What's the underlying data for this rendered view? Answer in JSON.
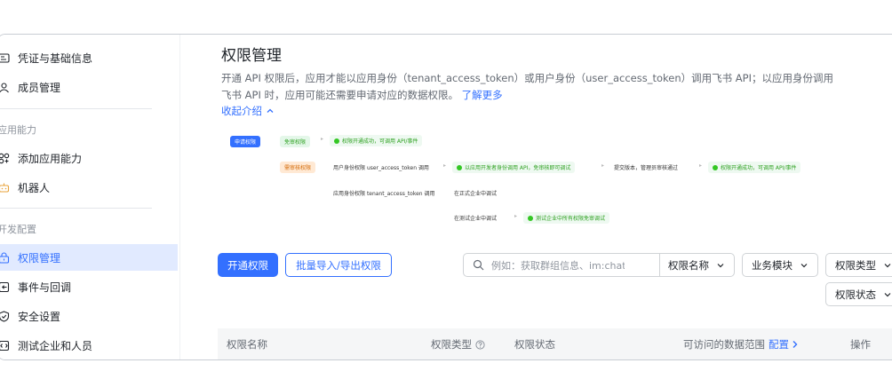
{
  "sidebar": {
    "items_top": [
      {
        "label": "凭证与基础信息",
        "icon": "credential-icon"
      },
      {
        "label": "成员管理",
        "icon": "members-icon"
      }
    ],
    "group_app": "应用能力",
    "items_app": [
      {
        "label": "添加应用能力",
        "icon": "add-capability-icon"
      },
      {
        "label": "机器人",
        "icon": "robot-icon"
      }
    ],
    "group_dev": "开发配置",
    "items_dev": [
      {
        "label": "权限管理",
        "icon": "permission-icon",
        "active": true
      },
      {
        "label": "事件与回调",
        "icon": "event-icon"
      },
      {
        "label": "安全设置",
        "icon": "security-icon"
      },
      {
        "label": "测试企业和人员",
        "icon": "test-org-icon"
      }
    ]
  },
  "page": {
    "title": "权限管理",
    "desc_main": "开通 API 权限后，应用才能以应用身份（tenant_access_token）或用户身份（user_access_token）调用飞书 API；以应用身份调用飞书 API 时，应用可能还需要申请对应的数据权限。",
    "desc_link": "了解更多",
    "collapse_label": "收起介绍"
  },
  "flow": {
    "apply": "申请权限",
    "no_review": "免审权限",
    "no_review_result": "权限开通成功，可调用 API/事件",
    "need_review": "需审核权限",
    "user_identity": "用户身份权限",
    "user_identity_token": "user_access_token 调用",
    "user_pill": "以应用开发者身份调用 API，免审核即可调试",
    "submit": "提交版本，管理员审核通过",
    "final_pill": "权限开通成功，可调用 API/事件",
    "app_identity": "应用身份权限",
    "app_identity_token": "tenant_access_token 调用",
    "formal_org": "在正式企业中调试",
    "test_org": "在测试企业中调试",
    "test_pill": "测试企业中所有权限免审调试"
  },
  "toolbar": {
    "enable_button": "开通权限",
    "import_export_button": "批量导入/导出权限",
    "search_placeholder": "例如：获取群组信息、im:chat",
    "search_select": "权限名称",
    "filter_module": "业务模块",
    "filter_type": "权限类型",
    "filter_status": "权限状态"
  },
  "table": {
    "col_name": "权限名称",
    "col_type": "权限类型",
    "col_status": "权限状态",
    "col_scope": "可访问的数据范围",
    "col_scope_link": "配置",
    "col_action": "操作"
  }
}
